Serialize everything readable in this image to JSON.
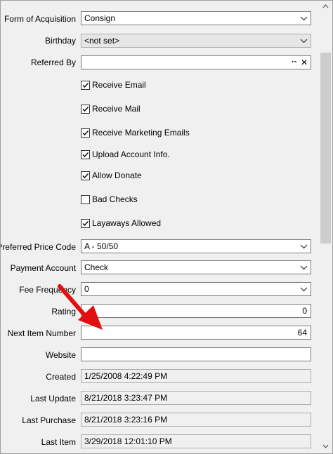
{
  "fields": {
    "form_of_acquisition": {
      "label": "Form of Acquisition",
      "value": "Consign"
    },
    "birthday": {
      "label": "Birthday",
      "value": "<not set>"
    },
    "referred_by": {
      "label": "Referred By",
      "value": "",
      "more": "···",
      "clear": "✕"
    },
    "preferred_price_code": {
      "label": "Preferred Price Code",
      "value": "A - 50/50"
    },
    "payment_account": {
      "label": "Payment Account",
      "value": "Check"
    },
    "fee_frequency": {
      "label": "Fee Frequency",
      "value": "0"
    },
    "rating": {
      "label": "Rating",
      "value": "0"
    },
    "next_item_number": {
      "label": "Next Item Number",
      "value": "64"
    },
    "website": {
      "label": "Website",
      "value": ""
    },
    "created": {
      "label": "Created",
      "value": "1/25/2008 4:22:49 PM"
    },
    "last_update": {
      "label": "Last Update",
      "value": "8/21/2018 3:23:47 PM"
    },
    "last_purchase": {
      "label": "Last Purchase",
      "value": "8/21/2018 3:23:16 PM"
    },
    "last_item": {
      "label": "Last Item",
      "value": "3/29/2018 12:01:10 PM"
    }
  },
  "checkboxes": [
    {
      "label": "Receive Email",
      "checked": true
    },
    {
      "label": "Receive Mail",
      "checked": true
    },
    {
      "label": "Receive Marketing Emails",
      "checked": true
    },
    {
      "label": "Upload Account Info.",
      "checked": true
    },
    {
      "label": "Allow Donate",
      "checked": true
    },
    {
      "label": "Bad Checks",
      "checked": false
    },
    {
      "label": "Layaways Allowed",
      "checked": true
    }
  ],
  "colors": {
    "annotation_arrow": "#e01010"
  }
}
